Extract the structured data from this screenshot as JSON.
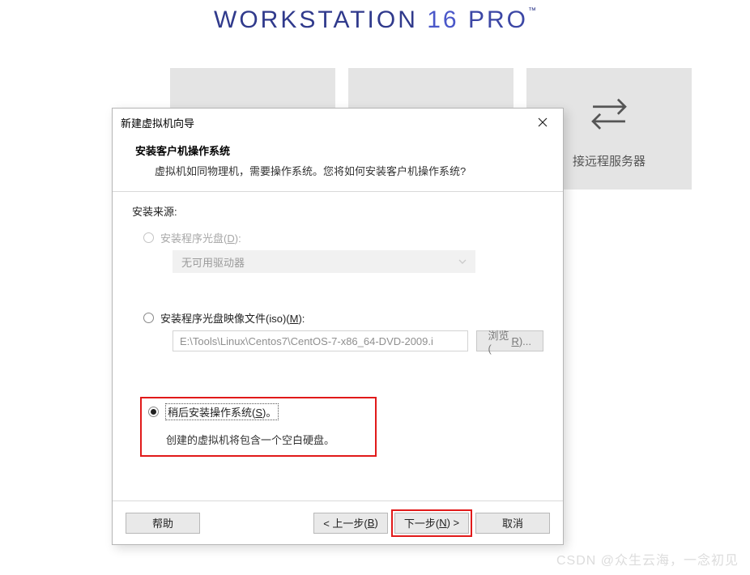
{
  "brand": {
    "name": "WORKSTATION",
    "version": "16",
    "edition": "PRO",
    "tm": "™"
  },
  "tiles": {
    "create": {
      "label": ""
    },
    "open": {
      "label": ""
    },
    "remote": {
      "label": "接远程服务器"
    }
  },
  "dialog": {
    "title": "新建虚拟机向导",
    "heading": "安装客户机操作系统",
    "subheading": "虚拟机如同物理机，需要操作系统。您将如何安装客户机操作系统?",
    "source_label": "安装来源:",
    "opt_disc": {
      "label_pre": "安装程序光盘(",
      "hot": "D",
      "label_post": "):"
    },
    "drive_dd": "无可用驱动器",
    "opt_iso": {
      "label_pre": "安装程序光盘映像文件(iso)(",
      "hot": "M",
      "label_post": "):"
    },
    "iso_path": "E:\\Tools\\Linux\\Centos7\\CentOS-7-x86_64-DVD-2009.i",
    "browse": {
      "pre": "浏览(",
      "hot": "R",
      "post": ")..."
    },
    "opt_later": {
      "label_pre": "稍后安装操作系统(",
      "hot": "S",
      "label_post": ")。"
    },
    "later_desc": "创建的虚拟机将包含一个空白硬盘。",
    "buttons": {
      "help": "帮助",
      "back": {
        "pre": "< 上一步(",
        "hot": "B",
        "post": ")"
      },
      "next": {
        "pre": "下一步(",
        "hot": "N",
        "post": ") >"
      },
      "cancel": "取消"
    }
  },
  "watermark": "CSDN @众生云海，一念初见"
}
